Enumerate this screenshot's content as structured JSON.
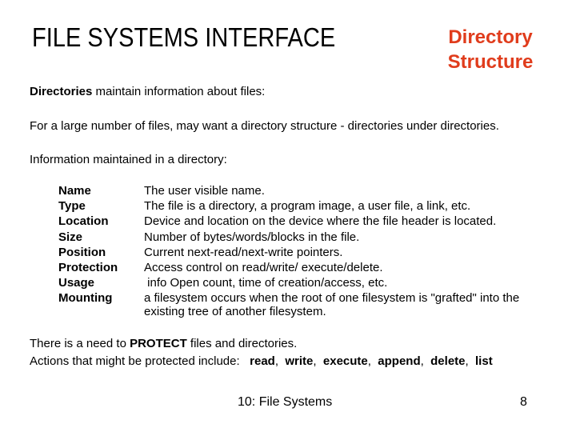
{
  "header": {
    "title": "FILE SYSTEMS INTERFACE",
    "subtitle_line1": "Directory",
    "subtitle_line2": "Structure",
    "subtitle_color": "#e03c1c"
  },
  "intro": {
    "p1_bold": "Directories",
    "p1_rest": " maintain information about files:",
    "p2": "For a large number of files, may want a directory structure - directories under directories.",
    "p3": "Information maintained in a directory:"
  },
  "attributes": [
    {
      "term": "Name",
      "desc": "The user visible name."
    },
    {
      "term": "Type",
      "desc": "The file is a directory, a program image, a user file, a link, etc."
    },
    {
      "term": "Location",
      "desc": "Device and location on the device where the file header is located."
    },
    {
      "term": "Size",
      "desc": "Number of bytes/words/blocks in the file."
    },
    {
      "term": "Position",
      "desc": "Current next-read/next-write pointers."
    },
    {
      "term": "Protection",
      "desc": "Access control on read/write/ execute/delete."
    },
    {
      "term": "Usage",
      "desc": " info Open count, time of creation/access, etc."
    },
    {
      "term": "Mounting",
      "desc": "a filesystem occurs when the root of one filesystem is \"grafted\" into the",
      "desc2": "existing tree of another filesystem."
    }
  ],
  "protection": {
    "line1_pre": "There is a need to ",
    "line1_bold": "PROTECT",
    "line1_post": " files and directories.",
    "line2_pre": "Actions that might be protected include:   ",
    "actions": [
      "read",
      "write",
      "execute",
      "append",
      "delete",
      "list"
    ]
  },
  "footer": {
    "chapter": "10: File Systems",
    "page": "8"
  }
}
